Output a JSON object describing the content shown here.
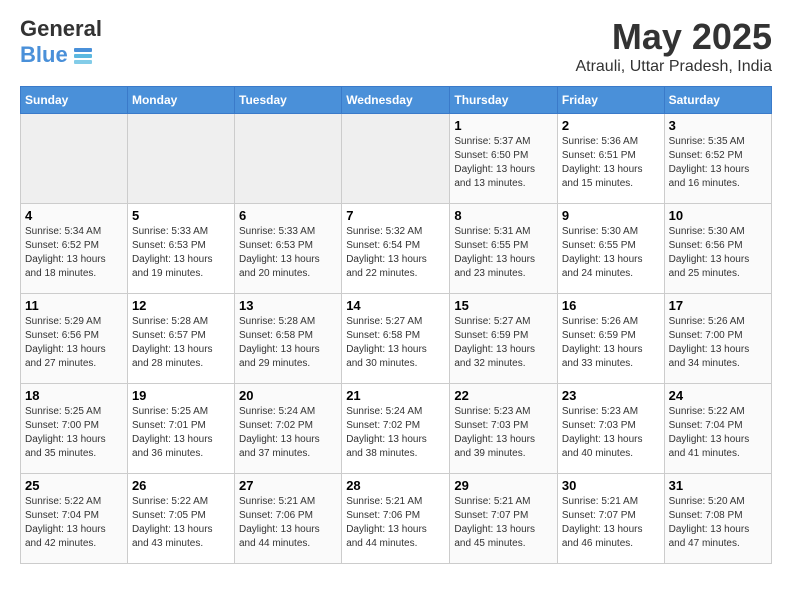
{
  "header": {
    "logo_g": "General",
    "logo_blue": "Blue",
    "title": "May 2025",
    "subtitle": "Atrauli, Uttar Pradesh, India"
  },
  "weekdays": [
    "Sunday",
    "Monday",
    "Tuesday",
    "Wednesday",
    "Thursday",
    "Friday",
    "Saturday"
  ],
  "weeks": [
    [
      {
        "day": "",
        "empty": true
      },
      {
        "day": "",
        "empty": true
      },
      {
        "day": "",
        "empty": true
      },
      {
        "day": "",
        "empty": true
      },
      {
        "day": "1",
        "sunrise": "5:37 AM",
        "sunset": "6:50 PM",
        "daylight": "13 hours and 13 minutes."
      },
      {
        "day": "2",
        "sunrise": "5:36 AM",
        "sunset": "6:51 PM",
        "daylight": "13 hours and 15 minutes."
      },
      {
        "day": "3",
        "sunrise": "5:35 AM",
        "sunset": "6:52 PM",
        "daylight": "13 hours and 16 minutes."
      }
    ],
    [
      {
        "day": "4",
        "sunrise": "5:34 AM",
        "sunset": "6:52 PM",
        "daylight": "13 hours and 18 minutes."
      },
      {
        "day": "5",
        "sunrise": "5:33 AM",
        "sunset": "6:53 PM",
        "daylight": "13 hours and 19 minutes."
      },
      {
        "day": "6",
        "sunrise": "5:33 AM",
        "sunset": "6:53 PM",
        "daylight": "13 hours and 20 minutes."
      },
      {
        "day": "7",
        "sunrise": "5:32 AM",
        "sunset": "6:54 PM",
        "daylight": "13 hours and 22 minutes."
      },
      {
        "day": "8",
        "sunrise": "5:31 AM",
        "sunset": "6:55 PM",
        "daylight": "13 hours and 23 minutes."
      },
      {
        "day": "9",
        "sunrise": "5:30 AM",
        "sunset": "6:55 PM",
        "daylight": "13 hours and 24 minutes."
      },
      {
        "day": "10",
        "sunrise": "5:30 AM",
        "sunset": "6:56 PM",
        "daylight": "13 hours and 25 minutes."
      }
    ],
    [
      {
        "day": "11",
        "sunrise": "5:29 AM",
        "sunset": "6:56 PM",
        "daylight": "13 hours and 27 minutes."
      },
      {
        "day": "12",
        "sunrise": "5:28 AM",
        "sunset": "6:57 PM",
        "daylight": "13 hours and 28 minutes."
      },
      {
        "day": "13",
        "sunrise": "5:28 AM",
        "sunset": "6:58 PM",
        "daylight": "13 hours and 29 minutes."
      },
      {
        "day": "14",
        "sunrise": "5:27 AM",
        "sunset": "6:58 PM",
        "daylight": "13 hours and 30 minutes."
      },
      {
        "day": "15",
        "sunrise": "5:27 AM",
        "sunset": "6:59 PM",
        "daylight": "13 hours and 32 minutes."
      },
      {
        "day": "16",
        "sunrise": "5:26 AM",
        "sunset": "6:59 PM",
        "daylight": "13 hours and 33 minutes."
      },
      {
        "day": "17",
        "sunrise": "5:26 AM",
        "sunset": "7:00 PM",
        "daylight": "13 hours and 34 minutes."
      }
    ],
    [
      {
        "day": "18",
        "sunrise": "5:25 AM",
        "sunset": "7:00 PM",
        "daylight": "13 hours and 35 minutes."
      },
      {
        "day": "19",
        "sunrise": "5:25 AM",
        "sunset": "7:01 PM",
        "daylight": "13 hours and 36 minutes."
      },
      {
        "day": "20",
        "sunrise": "5:24 AM",
        "sunset": "7:02 PM",
        "daylight": "13 hours and 37 minutes."
      },
      {
        "day": "21",
        "sunrise": "5:24 AM",
        "sunset": "7:02 PM",
        "daylight": "13 hours and 38 minutes."
      },
      {
        "day": "22",
        "sunrise": "5:23 AM",
        "sunset": "7:03 PM",
        "daylight": "13 hours and 39 minutes."
      },
      {
        "day": "23",
        "sunrise": "5:23 AM",
        "sunset": "7:03 PM",
        "daylight": "13 hours and 40 minutes."
      },
      {
        "day": "24",
        "sunrise": "5:22 AM",
        "sunset": "7:04 PM",
        "daylight": "13 hours and 41 minutes."
      }
    ],
    [
      {
        "day": "25",
        "sunrise": "5:22 AM",
        "sunset": "7:04 PM",
        "daylight": "13 hours and 42 minutes."
      },
      {
        "day": "26",
        "sunrise": "5:22 AM",
        "sunset": "7:05 PM",
        "daylight": "13 hours and 43 minutes."
      },
      {
        "day": "27",
        "sunrise": "5:21 AM",
        "sunset": "7:06 PM",
        "daylight": "13 hours and 44 minutes."
      },
      {
        "day": "28",
        "sunrise": "5:21 AM",
        "sunset": "7:06 PM",
        "daylight": "13 hours and 44 minutes."
      },
      {
        "day": "29",
        "sunrise": "5:21 AM",
        "sunset": "7:07 PM",
        "daylight": "13 hours and 45 minutes."
      },
      {
        "day": "30",
        "sunrise": "5:21 AM",
        "sunset": "7:07 PM",
        "daylight": "13 hours and 46 minutes."
      },
      {
        "day": "31",
        "sunrise": "5:20 AM",
        "sunset": "7:08 PM",
        "daylight": "13 hours and 47 minutes."
      }
    ]
  ],
  "labels": {
    "sunrise_prefix": "Sunrise: ",
    "sunset_prefix": "Sunset: ",
    "daylight_prefix": "Daylight: "
  }
}
